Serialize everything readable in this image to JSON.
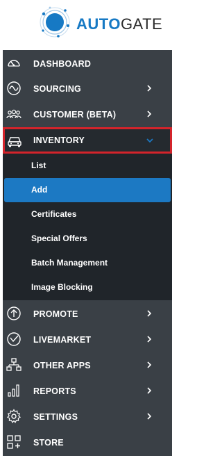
{
  "brand": {
    "part1": "AUTO",
    "part2": "GATE"
  },
  "colors": {
    "accent": "#1c79c3",
    "highlight_border": "#d3242b",
    "sidebar_bg": "#3a4046",
    "submenu_bg": "#20252a"
  },
  "nav": {
    "items": [
      {
        "label": "DASHBOARD",
        "icon": "speedometer-icon",
        "has_arrow": false
      },
      {
        "label": "SOURCING",
        "icon": "sourcing-wave-icon",
        "has_arrow": true
      },
      {
        "label": "CUSTOMER (BETA)",
        "icon": "users-icon",
        "has_arrow": true
      },
      {
        "label": "INVENTORY",
        "icon": "car-icon",
        "has_arrow": true,
        "expanded": true
      },
      {
        "label": "PROMOTE",
        "icon": "arrow-up-circle-icon",
        "has_arrow": true
      },
      {
        "label": "LIVEMARKET",
        "icon": "livemarket-icon",
        "has_arrow": true
      },
      {
        "label": "OTHER APPS",
        "icon": "sitemap-icon",
        "has_arrow": true
      },
      {
        "label": "REPORTS",
        "icon": "bar-chart-icon",
        "has_arrow": true
      },
      {
        "label": "SETTINGS",
        "icon": "gear-icon",
        "has_arrow": true
      },
      {
        "label": "STORE",
        "icon": "store-grid-icon",
        "has_arrow": false
      }
    ],
    "inventory_submenu": [
      {
        "label": "List",
        "active": false
      },
      {
        "label": "Add",
        "active": true
      },
      {
        "label": "Certificates",
        "active": false
      },
      {
        "label": "Special Offers",
        "active": false
      },
      {
        "label": "Batch Management",
        "active": false
      },
      {
        "label": "Image Blocking",
        "active": false
      }
    ]
  }
}
